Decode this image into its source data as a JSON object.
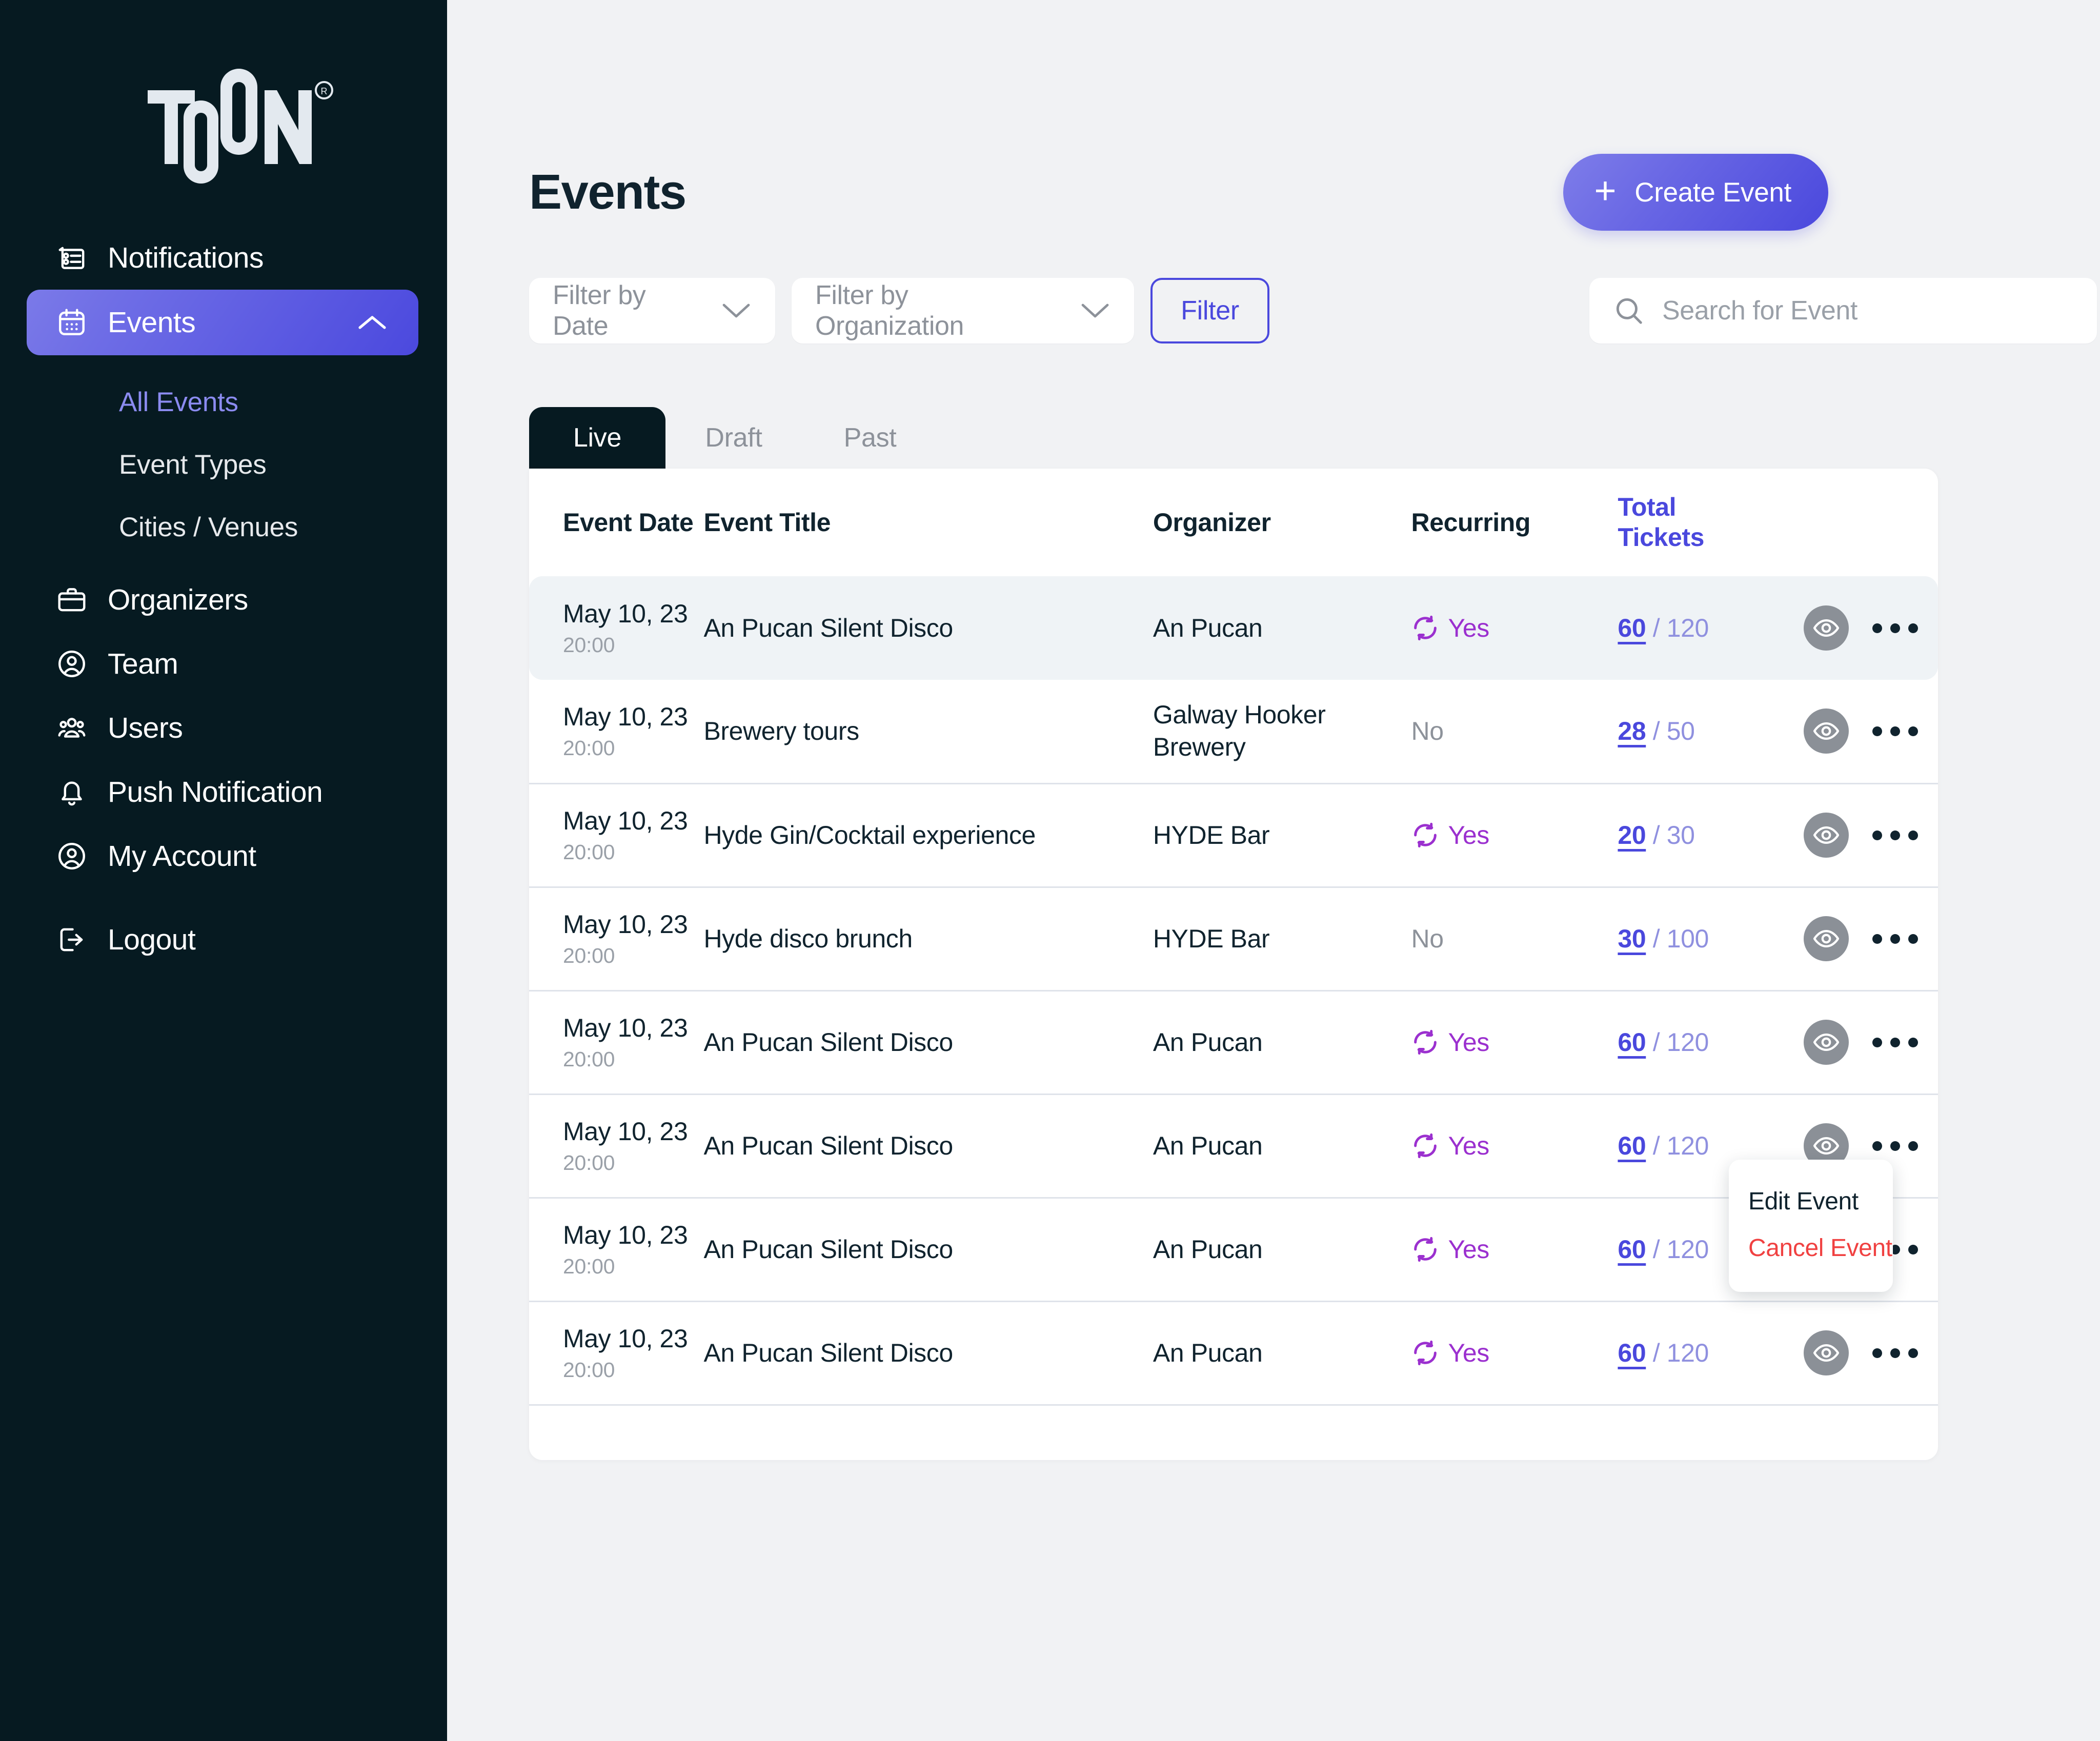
{
  "brand": {
    "name": "TOON",
    "trademark": "®"
  },
  "sidebar": {
    "items": [
      {
        "label": "Notifications",
        "icon": "notifications-list-icon"
      },
      {
        "label": "Events",
        "icon": "calendar-icon",
        "active": true,
        "chevron": "chevron-up-icon"
      },
      {
        "label": "Organizers",
        "icon": "briefcase-icon"
      },
      {
        "label": "Team",
        "icon": "user-circle-icon"
      },
      {
        "label": "Users",
        "icon": "users-group-icon"
      },
      {
        "label": "Push Notification",
        "icon": "bell-icon"
      },
      {
        "label": "My Account",
        "icon": "user-circle-icon"
      },
      {
        "label": "Logout",
        "icon": "logout-icon"
      }
    ],
    "subitems": [
      {
        "label": "All Events",
        "current": true
      },
      {
        "label": "Event Types",
        "current": false
      },
      {
        "label": "Cities / Venues",
        "current": false
      }
    ]
  },
  "header": {
    "title": "Events",
    "create_button": {
      "label": "Create Event",
      "icon": "plus-icon"
    }
  },
  "controls": {
    "filter_date": {
      "label": "Filter by Date",
      "icon": "chevron-down-icon"
    },
    "filter_org": {
      "label": "Filter by Organization",
      "icon": "chevron-down-icon"
    },
    "filter_button": "Filter",
    "search": {
      "placeholder": "Search for Event",
      "value": "",
      "icon": "search-icon"
    }
  },
  "tabs": [
    {
      "label": "Live",
      "active": true
    },
    {
      "label": "Draft",
      "active": false
    },
    {
      "label": "Past",
      "active": false
    }
  ],
  "table": {
    "columns": [
      "Event Date",
      "Event Title",
      "Organizer",
      "Recurring",
      "Total",
      "Tickets"
    ],
    "headers": {
      "date": "Event Date",
      "title": "Event Title",
      "organizer": "Organizer",
      "recurring": "Recurring",
      "tickets_line1": "Total",
      "tickets_line2": "Tickets"
    },
    "rows": [
      {
        "date": "May 10, 23",
        "time": "20:00",
        "title": "An Pucan Silent Disco",
        "organizer": "An Pucan",
        "recurring": "Yes",
        "sold": "60",
        "capacity": "/ 120",
        "highlight": true
      },
      {
        "date": "May 10, 23",
        "time": "20:00",
        "title": "Brewery tours",
        "organizer": "Galway Hooker Brewery",
        "recurring": "No",
        "sold": "28",
        "capacity": "/ 50",
        "highlight": false
      },
      {
        "date": "May 10, 23",
        "time": "20:00",
        "title": "Hyde Gin/Cocktail experience",
        "organizer": "HYDE Bar",
        "recurring": "Yes",
        "sold": "20",
        "capacity": "/ 30",
        "highlight": false
      },
      {
        "date": "May 10, 23",
        "time": "20:00",
        "title": "Hyde disco brunch",
        "organizer": "HYDE Bar",
        "recurring": "No",
        "sold": "30",
        "capacity": "/ 100",
        "highlight": false
      },
      {
        "date": "May 10, 23",
        "time": "20:00",
        "title": "An Pucan Silent Disco",
        "organizer": "An Pucan",
        "recurring": "Yes",
        "sold": "60",
        "capacity": "/ 120",
        "highlight": false
      },
      {
        "date": "May 10, 23",
        "time": "20:00",
        "title": "An Pucan Silent Disco",
        "organizer": "An Pucan",
        "recurring": "Yes",
        "sold": "60",
        "capacity": "/ 120",
        "highlight": false
      },
      {
        "date": "May 10, 23",
        "time": "20:00",
        "title": "An Pucan Silent Disco",
        "organizer": "An Pucan",
        "recurring": "Yes",
        "sold": "60",
        "capacity": "/ 120",
        "highlight": false
      },
      {
        "date": "May 10, 23",
        "time": "20:00",
        "title": "An Pucan Silent Disco",
        "organizer": "An Pucan",
        "recurring": "Yes",
        "sold": "60",
        "capacity": "/ 120",
        "highlight": false
      }
    ]
  },
  "context_menu": {
    "visible": true,
    "items": [
      {
        "label": "Edit Event",
        "variant": "edit"
      },
      {
        "label": "Cancel Event",
        "variant": "cancel"
      }
    ]
  },
  "colors": {
    "sidebar_bg": "#061a21",
    "accent": "#4a48dd",
    "accent_light": "#7e7de9",
    "recurring_yes": "#9b30cf",
    "danger": "#f04141",
    "page_bg": "#f1f2f4",
    "muted": "#8d929a"
  }
}
